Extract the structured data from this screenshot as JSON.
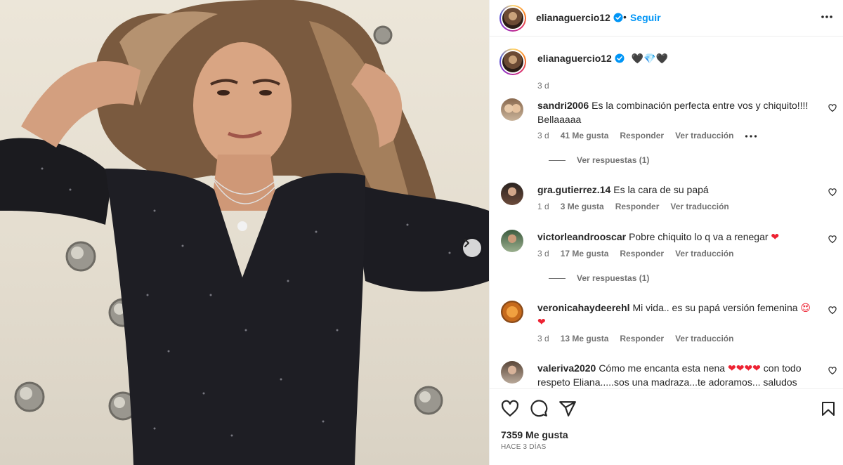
{
  "post": {
    "author": "elianaguercio12",
    "follow_label": "Seguir",
    "separator": "•",
    "caption_emojis": "🖤💎🖤",
    "caption_time": "3 d",
    "likes": "7359 Me gusta",
    "posted_ago": "HACE 3 DÍAS"
  },
  "comments": [
    {
      "user": "sandri2006",
      "text": "Es la combinación perfecta entre vos y chiquito!!!! Bellaaaaa",
      "time": "3 d",
      "likes": "41 Me gusta",
      "reply": "Responder",
      "translate": "Ver traducción",
      "replies": "Ver respuestas (1)"
    },
    {
      "user": "gra.gutierrez.14",
      "text": "Es la cara de su papá",
      "time": "1 d",
      "likes": "3 Me gusta",
      "reply": "Responder",
      "translate": "Ver traducción"
    },
    {
      "user": "victorleandrooscar",
      "text": "Pobre chiquito lo q va a renegar",
      "emoji": "❤",
      "time": "3 d",
      "likes": "17 Me gusta",
      "reply": "Responder",
      "translate": "Ver traducción",
      "replies": "Ver respuestas (1)"
    },
    {
      "user": "veronicahaydeerehl",
      "text": "Mi vida.. es su papá versión femenina",
      "emoji": "😍 ❤",
      "time": "3 d",
      "likes": "13 Me gusta",
      "reply": "Responder",
      "translate": "Ver traducción"
    },
    {
      "user": "valeriva2020",
      "text": "Cómo me encanta esta nena",
      "emoji": "❤❤❤❤",
      "text2": "con todo respeto Eliana.....sos una madraza...te adoramos... saludos"
    }
  ],
  "icons": {
    "verified": "verified-badge-icon",
    "more": "more-options-icon",
    "like": "heart-icon",
    "comment": "comment-icon",
    "share": "share-icon",
    "save": "bookmark-icon",
    "next": "chevron-right-icon"
  },
  "colors": {
    "accent": "#0095f6",
    "verified": "#0095f6",
    "heart": "#ed2232",
    "muted": "#737373"
  }
}
